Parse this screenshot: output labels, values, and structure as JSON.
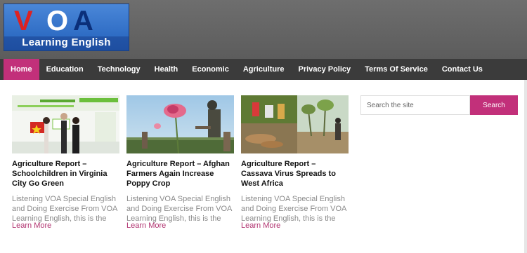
{
  "logo": {
    "mark_v": "V",
    "mark_o": "O",
    "mark_a": "A",
    "text": "Learning English"
  },
  "nav": {
    "items": [
      {
        "label": "Home",
        "active": true
      },
      {
        "label": "Education"
      },
      {
        "label": "Technology"
      },
      {
        "label": "Health"
      },
      {
        "label": "Economic"
      },
      {
        "label": "Agriculture"
      },
      {
        "label": "Privacy Policy"
      },
      {
        "label": "Terms Of Service"
      },
      {
        "label": "Contact Us"
      }
    ]
  },
  "posts": [
    {
      "title": "Agriculture Report – Schoolchildren in Virginia City Go Green",
      "excerpt": "Listening VOA Special English and Doing Exercise From VOA Learning English, this is the",
      "more": "Learn More",
      "image": "ceremony-photo"
    },
    {
      "title": "Agriculture Report – Afghan Farmers Again Increase Poppy Crop",
      "excerpt": "Listening VOA Special English and Doing Exercise From VOA Learning English, this is the",
      "more": "Learn More",
      "image": "poppy-field-photo"
    },
    {
      "title": "Agriculture Report – Cassava Virus Spreads to West Africa",
      "excerpt": "Listening VOA Special English and Doing Exercise From VOA Learning English, this is the",
      "more": "Learn More",
      "image": "cassava-farm-photo"
    }
  ],
  "search": {
    "placeholder": "Search the site",
    "button": "Search"
  },
  "colors": {
    "accent": "#c2307a",
    "nav_bg": "#3b3b3b",
    "header_bg": "#5e5e5e"
  }
}
